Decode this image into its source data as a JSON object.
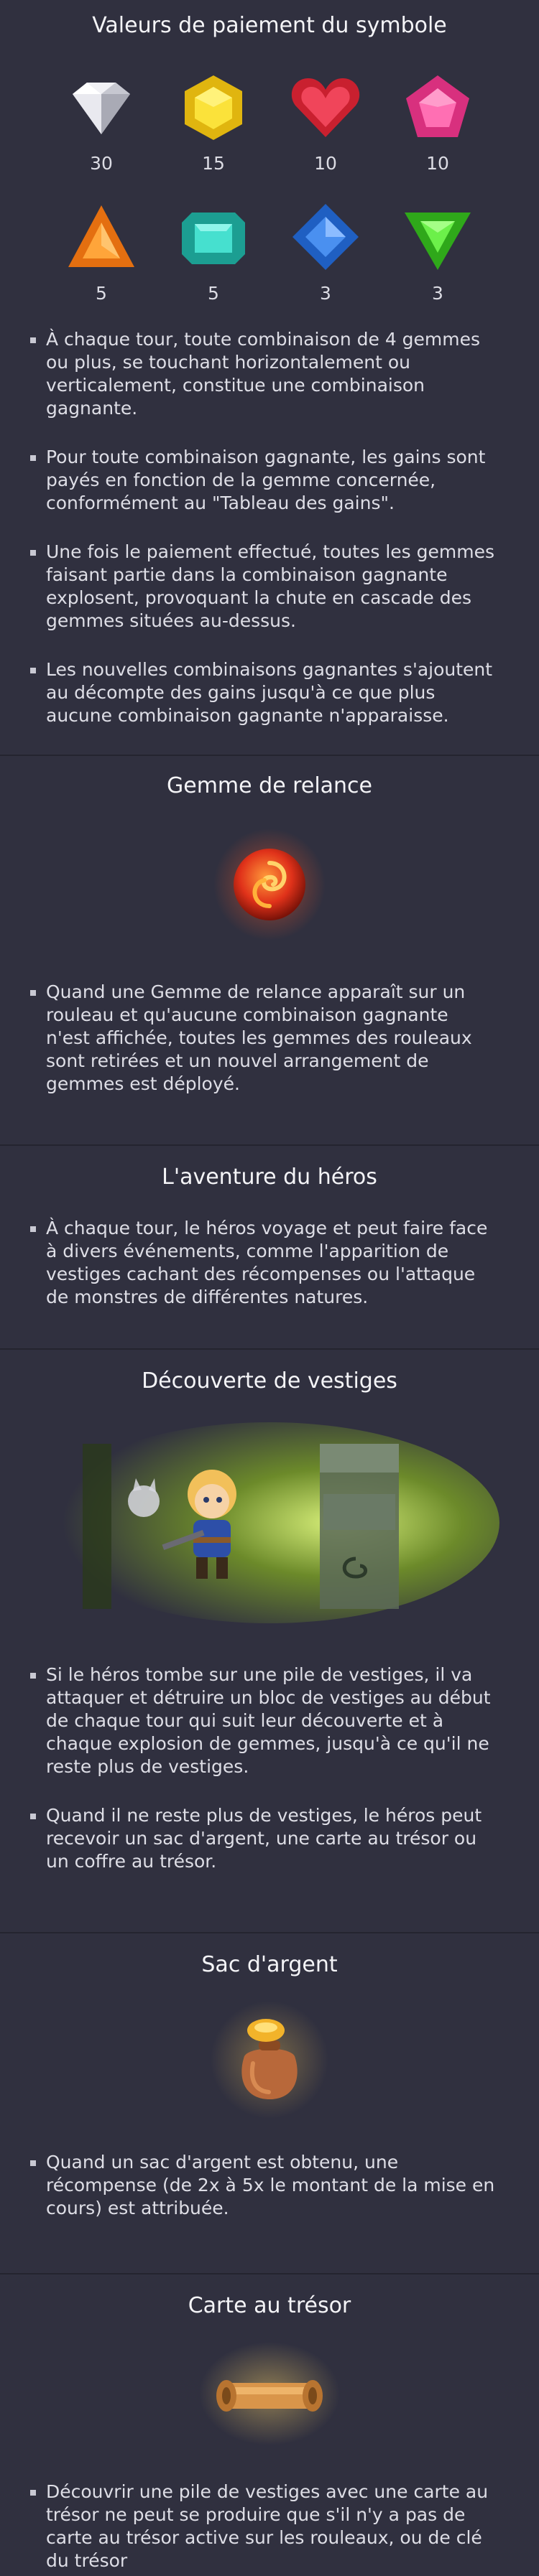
{
  "symbol_payouts": {
    "title": "Valeurs de paiement du symbole",
    "gems": [
      {
        "icon": "white-diamond-icon",
        "value": "30",
        "color": "#e8e8ee"
      },
      {
        "icon": "yellow-hexagon-gem-icon",
        "value": "15",
        "color": "#f2d21a"
      },
      {
        "icon": "red-heart-gem-icon",
        "value": "10",
        "color": "#e0303e"
      },
      {
        "icon": "pink-pentagon-gem-icon",
        "value": "10",
        "color": "#f04a9a"
      },
      {
        "icon": "orange-triangle-gem-icon",
        "value": "5",
        "color": "#f2881c"
      },
      {
        "icon": "teal-emerald-gem-icon",
        "value": "5",
        "color": "#2ec8b8"
      },
      {
        "icon": "blue-square-gem-icon",
        "value": "3",
        "color": "#3a7fe0"
      },
      {
        "icon": "green-triangle-gem-icon",
        "value": "3",
        "color": "#4cd82a"
      }
    ],
    "bullets": [
      "À chaque tour, toute combinaison de 4 gemmes ou plus, se touchant horizontalement ou verticalement, constitue une combinaison gagnante.",
      "Pour toute combinaison gagnante, les gains sont payés en fonction de la gemme concernée, conformément au \"Tableau des gains\".",
      "Une fois le paiement effectué, toutes les gemmes faisant partie dans la combinaison gagnante explosent, provoquant la chute en cascade des gemmes situées au-dessus.",
      "Les nouvelles combinaisons gagnantes s'ajoutent au décompte des gains jusqu'à ce que plus aucune combinaison gagnante n'apparaisse."
    ]
  },
  "reroll_gem": {
    "title": "Gemme de relance",
    "icon": "swirl-orb-icon",
    "bullets": [
      "Quand une Gemme de relance apparaît sur un rouleau et qu'aucune combinaison gagnante n'est affichée, toutes les gemmes des rouleaux sont retirées et un nouvel arrangement de gemmes est déployé."
    ]
  },
  "hero_adventure": {
    "title": "L'aventure du héros",
    "bullets": [
      "À chaque tour, le héros voyage et peut faire face à divers événements, comme l'apparition de vestiges cachant des récompenses ou l'attaque de monstres de différentes natures."
    ]
  },
  "relic_discovery": {
    "title": "Découverte de vestiges",
    "illustration": "hero-at-ruins-illustration",
    "bullets": [
      "Si le héros tombe sur une pile de vestiges, il va attaquer et détruire un bloc de vestiges au début de chaque tour qui suit leur découverte et à chaque explosion de gemmes, jusqu'à ce qu'il ne reste plus de vestiges.",
      "Quand il ne reste plus de vestiges, le héros peut recevoir un sac d'argent, une carte au trésor ou un coffre au trésor."
    ]
  },
  "money_bag": {
    "title": "Sac d'argent",
    "icon": "money-bag-icon",
    "bullets": [
      "Quand un sac d'argent est obtenu, une récompense (de 2x à 5x le montant de la mise en cours) est attribuée."
    ]
  },
  "treasure_map": {
    "title": "Carte au trésor",
    "icon": "scroll-map-icon",
    "bullets": [
      "Découvrir une pile de vestiges avec une carte au trésor ne peut se produire que s'il n'y a pas de carte au trésor active sur les rouleaux, ou de clé du trésor"
    ]
  }
}
